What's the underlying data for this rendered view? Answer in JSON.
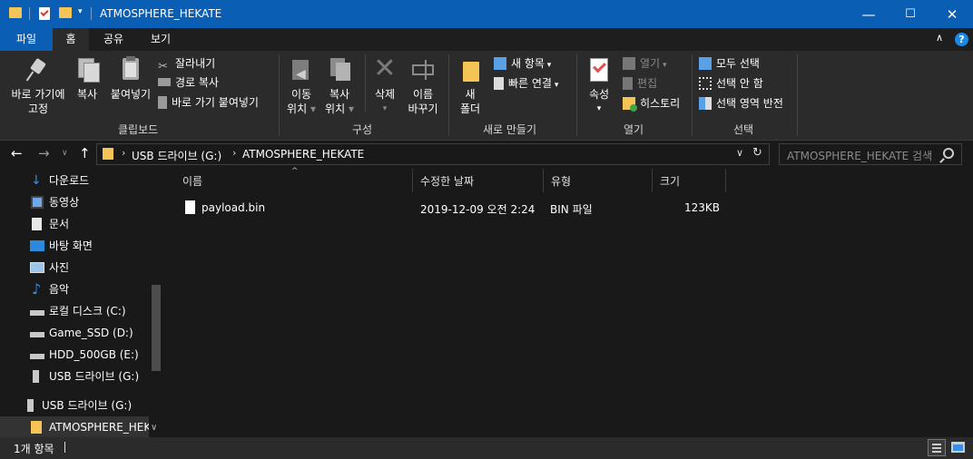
{
  "window": {
    "title": "ATMOSPHERE_HEKATE",
    "controls": {
      "minimize": "—",
      "maximize": "☐",
      "close": "✕"
    }
  },
  "ribbon_tabs": {
    "file": "파일",
    "home": "홈",
    "share": "공유",
    "view": "보기"
  },
  "ribbon": {
    "clipboard": {
      "pin": "바로 가기에\n고정",
      "copy": "복사",
      "paste": "붙여넣기",
      "cut": "잘라내기",
      "copy_path": "경로 복사",
      "paste_shortcut": "바로 가기 붙여넣기",
      "label": "클립보드"
    },
    "organize": {
      "move": "이동\n위치",
      "copy_to": "복사\n위치",
      "delete": "삭제",
      "rename": "이름\n바꾸기",
      "label": "구성"
    },
    "new": {
      "new_folder": "새\n폴더",
      "new_item": "새 항목",
      "easy_access": "빠른 연결",
      "label": "새로 만들기"
    },
    "open": {
      "properties": "속성",
      "open": "열기",
      "edit": "편집",
      "history": "히스토리",
      "label": "열기"
    },
    "select": {
      "select_all": "모두 선택",
      "select_none": "선택 안 함",
      "invert": "선택 영역 반전",
      "label": "선택"
    }
  },
  "nav": {
    "back": "←",
    "forward": "→",
    "recent": "∨",
    "up": "↑",
    "breadcrumb": [
      "USB 드라이브 (G:)",
      "ATMOSPHERE_HEKATE"
    ],
    "search_placeholder": "ATMOSPHERE_HEKATE 검색"
  },
  "sidebar": {
    "items": [
      {
        "label": "다운로드",
        "icon": "download-icon"
      },
      {
        "label": "동영상",
        "icon": "video-icon"
      },
      {
        "label": "문서",
        "icon": "document-icon"
      },
      {
        "label": "바탕 화면",
        "icon": "desktop-icon"
      },
      {
        "label": "사진",
        "icon": "picture-icon"
      },
      {
        "label": "음악",
        "icon": "music-icon"
      },
      {
        "label": "로컬 디스크 (C:)",
        "icon": "drive-icon"
      },
      {
        "label": "Game_SSD (D:)",
        "icon": "drive-icon"
      },
      {
        "label": "HDD_500GB (E:)",
        "icon": "drive-icon"
      },
      {
        "label": "USB 드라이브 (G:)",
        "icon": "usb-icon"
      },
      {
        "label": "USB 드라이브 (G:)",
        "icon": "usb-icon"
      },
      {
        "label": "ATMOSPHERE_HEKA",
        "icon": "folder-icon"
      }
    ]
  },
  "columns": {
    "name": "이름",
    "modified": "수정한 날짜",
    "type": "유형",
    "size": "크기"
  },
  "files": [
    {
      "name": "payload.bin",
      "modified": "2019-12-09 오전 2:24",
      "type": "BIN 파일",
      "size": "123KB"
    }
  ],
  "status": {
    "count": "1개 항목"
  }
}
